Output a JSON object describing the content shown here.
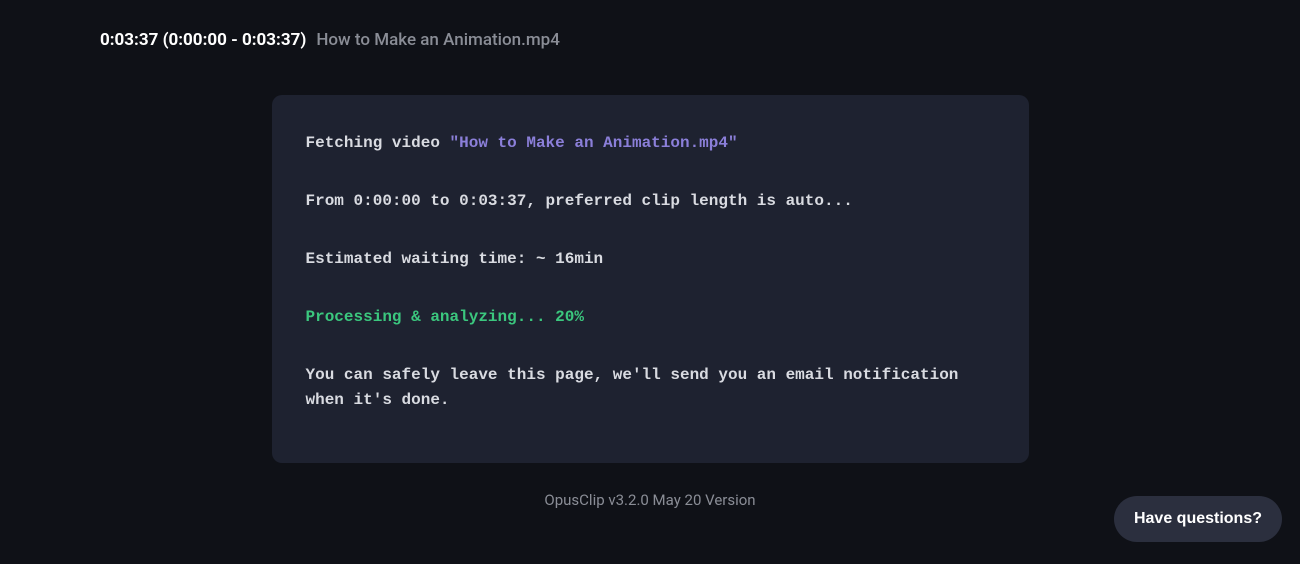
{
  "header": {
    "timestamp": "0:03:37 (0:00:00 - 0:03:37)",
    "filename": "How to Make an Animation.mp4"
  },
  "console": {
    "fetching_prefix": "Fetching video ",
    "video_name": "\"How to Make an Animation.mp4\"",
    "range_line": "From 0:00:00 to 0:03:37, preferred clip length is auto...",
    "eta_line": "Estimated waiting time: ~ 16min",
    "progress_line": "Processing & analyzing... 20%",
    "notice_line": "You can safely leave this page, we'll send you an email notification when it's done."
  },
  "footer": {
    "version": "OpusClip v3.2.0 May 20 Version"
  },
  "help": {
    "label": "Have questions?"
  }
}
